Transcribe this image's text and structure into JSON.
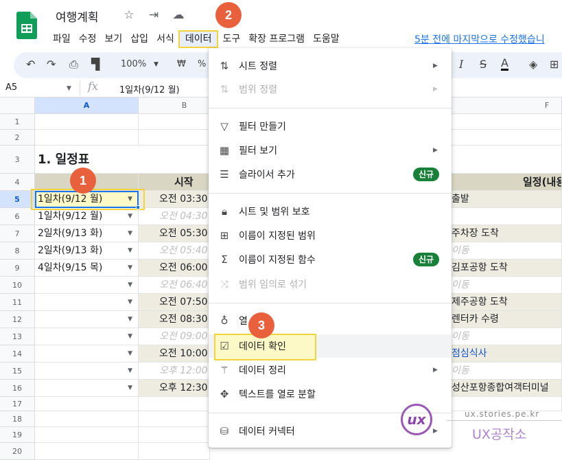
{
  "header": {
    "title": "여행계획",
    "last_edit": "5분 전에 마지막으로 수정했습니",
    "menus": [
      "파일",
      "수정",
      "보기",
      "삽입",
      "서식",
      "데이터",
      "도구",
      "확장 프로그램",
      "도움말"
    ]
  },
  "toolbar": {
    "zoom": "100%",
    "currency": "₩",
    "percent": "%"
  },
  "formula_bar": {
    "cell_ref": "A5",
    "fx": "fx",
    "value": "1일차(9/12 월)"
  },
  "grid": {
    "columns": [
      "A",
      "B",
      "F"
    ],
    "rows": [
      "1",
      "2",
      "3",
      "4",
      "5",
      "6",
      "7",
      "8",
      "9",
      "10",
      "11",
      "12",
      "13",
      "14",
      "15",
      "16",
      "17",
      "18",
      "19",
      "20"
    ],
    "section_title": "1. 일정표",
    "header_b": "시작",
    "header_f": "일정(내용",
    "col_a": [
      "1일차(9/12 월)",
      "1일차(9/12 월)",
      "2일차(9/13 화)",
      "2일차(9/13 화)",
      "4일차(9/15 목)"
    ],
    "col_b": [
      "오전 03:30",
      "오전 04:30",
      "오전 05:30",
      "오전 05:40",
      "오전 06:00",
      "오전 06:40",
      "오전 07:50",
      "오전 08:30",
      "오전 09:00",
      "오전 10:00",
      "오후 12:00",
      "오후 12:30"
    ],
    "col_f": [
      "출발",
      "",
      "주차장 도착",
      "이동",
      "김포공항 도착",
      "이동",
      "제주공항 도착",
      "렌터카 수령",
      "이동",
      "점심식사",
      "이동",
      "성산포항종합여객터미널"
    ]
  },
  "data_menu": {
    "items": [
      {
        "label": "시트 정렬",
        "icon": "sort-icon"
      },
      {
        "label": "범위 정렬",
        "icon": "sort-range-icon"
      },
      {
        "label": "필터 만들기",
        "icon": "filter-icon"
      },
      {
        "label": "필터 보기",
        "icon": "filter-view-icon"
      },
      {
        "label": "슬라이서 추가",
        "icon": "slicer-icon",
        "badge": "신규"
      },
      {
        "label": "시트 및 범위 보호",
        "icon": "lock-icon"
      },
      {
        "label": "이름이 지정된 범위",
        "icon": "named-range-icon"
      },
      {
        "label": "이름이 지정된 함수",
        "icon": "sigma-icon",
        "badge": "신규"
      },
      {
        "label": "범위 임의로 섞기",
        "icon": "shuffle-icon"
      },
      {
        "label": "열",
        "icon": "bulb-icon"
      },
      {
        "label": "데이터 확인",
        "icon": "data-validation-icon"
      },
      {
        "label": "데이터 정리",
        "icon": "magic-wand-icon"
      },
      {
        "label": "텍스트를 열로 분할",
        "icon": "split-icon"
      },
      {
        "label": "데이터 커넥터",
        "icon": "database-icon"
      }
    ]
  },
  "callouts": [
    "1",
    "2",
    "3"
  ],
  "watermark": {
    "site": "ux.stories.pe.kr",
    "name": "UX공작소",
    "logo": "ux"
  },
  "colors": {
    "accent_yellow": "#f2d33b",
    "callout": "#e8613c",
    "header_fill": "#d9d6c3",
    "row_fill": "#eeece1",
    "badge_green": "#188038"
  }
}
